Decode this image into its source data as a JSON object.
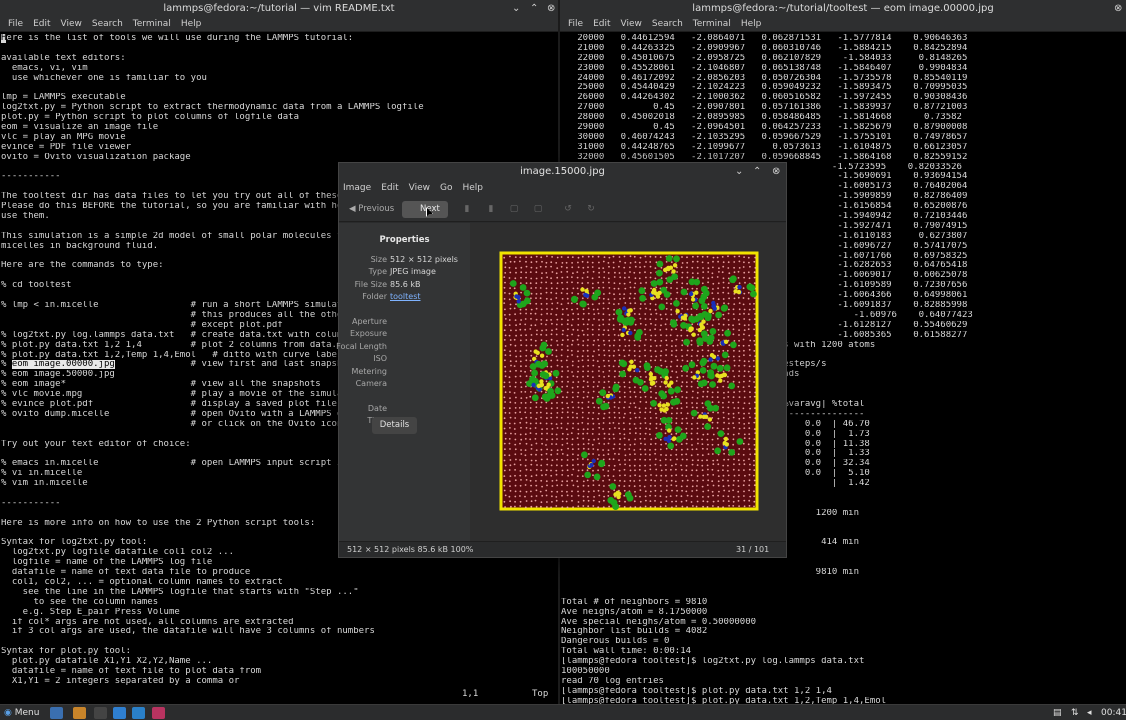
{
  "left_terminal": {
    "title": "lammps@fedora:~/tutorial — vim README.txt",
    "menu": [
      "File",
      "Edit",
      "View",
      "Search",
      "Terminal",
      "Help"
    ],
    "lines": [
      "Here is the list of tools we will use during the LAMMPS tutorial:",
      "",
      "available text editors:",
      "  emacs, vi, vim",
      "  use whichever one is familiar to you",
      "",
      "lmp = LAMMPS executable",
      "log2txt.py = Python script to extract thermodynamic data from a LAMMPS logfile",
      "plot.py = Python script to plot columns of logfile data",
      "eom = visualize an image file",
      "vlc = play an MPG movie",
      "evince = PDF file viewer",
      "ovito = Ovito visualization package",
      "",
      "-----------",
      "",
      "The tooltest dir has data files to let you try out all of these tool",
      "Please do this BEFORE the tutorial, so you are familiar with how to",
      "use them.",
      "",
      "This simulation is a simple 2d model of small polar molecules formin",
      "micelles in background fluid.",
      "",
      "Here are the commands to type:",
      "",
      "% cd tooltest",
      "",
      "% lmp < in.micelle                 # run a short LAMMPS simulation",
      "                                   # this produces all the other fi",
      "                                   # except plot.pdf",
      "% log2txt.py log.lammps data.txt   # create data.txt with columns o",
      "% plot.py data.txt 1,2 1,4         # plot 2 columns from data.txt",
      "% plot.py data.txt 1,2,Temp 1,4,Emol   # ditto with curve labels",
      "% eom image.00000.jpg              # view first and last snapshots",
      "% eom image.50000.jpg",
      "% eom image*                       # view all the snapshots",
      "% vlc movie.mpg                    # play a movie of the simulation",
      "% evince plot.pdf                  # display a saved plot file",
      "% ovito dump.micelle               # open Ovito with a LAMMPS dump",
      "                                   # or click on the Ovito icon to",
      "",
      "Try out your text editor of choice:",
      "",
      "% emacs in.micelle                 # open LAMMPS input script in a",
      "% vi in.micelle",
      "% vim in.micelle",
      "",
      "-----------",
      "",
      "Here is more info on how to use the 2 Python script tools:",
      "",
      "Syntax for log2txt.py tool:",
      "  log2txt.py logfile datafile col1 col2 ...",
      "  logfile = name of the LAMMPS log file",
      "  datafile = name of text data file to produce",
      "  col1, col2, ... = optional column names to extract",
      "    see the line in the LAMMPS logfile that starts with \"Step ...\"",
      "      to see the column names",
      "    e.g. Step E_pair Press Volume",
      "  if col* args are not used, all columns are extracted",
      "  if 3 col args are used, the datafile will have 3 columns of numbers",
      "",
      "Syntax for plot.py tool:",
      "  plot.py datafile X1,Y1 X2,Y2,Name ...",
      "  datafile = name of text file to plot data from",
      "  X1,Y1 = 2 integers separated by a comma or"
    ],
    "highlight_text": "eom image.00000.jpg",
    "cursor_pos": "1,1",
    "scroll_pos": "Top"
  },
  "right_terminal": {
    "title": "lammps@fedora:~/tutorial/tooltest — eom image.00000.jpg",
    "menu": [
      "File",
      "Edit",
      "View",
      "Search",
      "Terminal",
      "Help"
    ],
    "lines": [
      "   20000   0.44612594   -2.0864071   0.062871531   -1.5777814    0.90646363",
      "   21000   0.44263325   -2.0909967   0.060310746   -1.5884215    0.84252894",
      "   22000   0.45010675   -2.0958725   0.062107829    -1.584033     0.8148265",
      "   23000   0.45528061   -2.1046807   0.065138748   -1.5846407     0.9904834",
      "   24000   0.46172092   -2.0856203   0.050726304   -1.5735578    0.85540119",
      "   25000   0.45440429   -2.1024223   0.059049232   -1.5893475    0.70995035",
      "   26000   0.44264302   -2.1000362   0.060516582   -1.5972455    0.90308436",
      "   27000         0.45   -2.0907801   0.057161386   -1.5839937    0.87721003",
      "   28000   0.45002018   -2.0895985   0.058486485   -1.5814668      0.73582",
      "   29000         0.45   -2.0964501   0.064257233   -1.5825679    0.87900008",
      "   30000   0.46074243   -2.1035295   0.059667529   -1.5755101    0.74978657",
      "   31000   0.44248765   -2.1099677     0.0573613   -1.6104875    0.66123057",
      "   32000   0.45601505   -2.1017207   0.059668845   -1.5864168    0.82559152",
      "                                                  -1.5723595    0.82033526",
      "                                                   -1.5690691    0.93694154",
      "                                                   -1.6005173    0.76402064",
      "                                                   -1.5909859    0.82786409",
      "                                                   -1.6156854    0.65200876",
      "                                                   -1.5940942    0.72103446",
      "                                                   -1.5927471    0.79074915",
      "                                                   -1.6110183     0.6273807",
      "                                                   -1.6096727    0.57417075",
      "                                                   -1.6071766    0.69758325",
      "                                                   -1.6282653    0.64765418",
      "                                                   -1.6069017    0.60625078",
      "                                                   -1.6109589    0.72307656",
      "                                                   -1.6064366    0.64998061",
      "                                                   -1.6091837    0.82885998",
      "                                                      -1.60976    0.64077423",
      "                                                   -1.6128127    0.55460629",
      "                                                   -1.6085365    0.61588277",
      "                                        ps with 1200 atoms",
      "",
      "                                        mesteps/s",
      "                                        eads",
      "",
      "",
      "                                        |%varavg| %total",
      "                                        ----------------",
      "                                         |   0.0  | 46.70",
      "                                         |   0.0  |  1.73",
      "                                         |   0.0  | 11.38",
      "                                         |   0.0  |  1.33",
      "                                         |   0.0  | 32.34",
      "                                         |   0.0  |  5.10",
      "                                         |        |  1.42",
      "",
      "",
      "                                               1200 min",
      "",
      "",
      "                                                414 min",
      "",
      "",
      "                                               9810 min",
      "",
      "",
      "Total # of neighbors = 9810",
      "Ave neighs/atom = 8.1750000",
      "Ave special neighs/atom = 0.50000000",
      "Neighbor list builds = 4082",
      "Dangerous builds = 0",
      "Total wall time: 0:00:14",
      "[lammps@fedora tooltest]$ log2txt.py log.lammps data.txt",
      "100050000",
      "read 70 log entries",
      "[lammps@fedora tooltest]$ plot.py data.txt 1,2 1,4",
      "[lammps@fedora tooltest]$ plot.py data.txt 1,2,Temp 1,4,Emol",
      "[lammps@fedora tooltest]$ eom image.00000.jpg",
      ""
    ]
  },
  "eom": {
    "title": "image.15000.jpg",
    "menu": [
      "Image",
      "Edit",
      "View",
      "Go",
      "Help"
    ],
    "previous_label": "Previous",
    "next_label": "Next",
    "properties_heading": "Properties",
    "props": [
      {
        "key": "Size",
        "value": "512 × 512 pixels"
      },
      {
        "key": "Type",
        "value": "JPEG image"
      },
      {
        "key": "File Size",
        "value": "85.6 kB"
      },
      {
        "key": "Folder",
        "value": "tooltest",
        "link": true
      },
      {
        "key": "",
        "value": ""
      },
      {
        "key": "Aperture",
        "value": ""
      },
      {
        "key": "Exposure",
        "value": ""
      },
      {
        "key": "Focal Length",
        "value": ""
      },
      {
        "key": "ISO",
        "value": ""
      },
      {
        "key": "Metering",
        "value": ""
      },
      {
        "key": "Camera",
        "value": ""
      },
      {
        "key": "",
        "value": ""
      },
      {
        "key": "Date",
        "value": ""
      },
      {
        "key": "Time",
        "value": ""
      }
    ],
    "details_label": "Details",
    "status_left": "512 × 512 pixels  85.6 kB  100%",
    "status_page": "31 / 101"
  },
  "taskbar": {
    "menu_label": "Menu",
    "clock": "00:41"
  },
  "colors": {
    "term_bg": "#000000",
    "term_fg": "#d8d8d8",
    "sim_bg": "#5a0b10",
    "sim_border": "#f2e400",
    "bead_green": "#1fa51c",
    "bead_yellow": "#e8e020",
    "bead_blue": "#1a2fb8"
  }
}
